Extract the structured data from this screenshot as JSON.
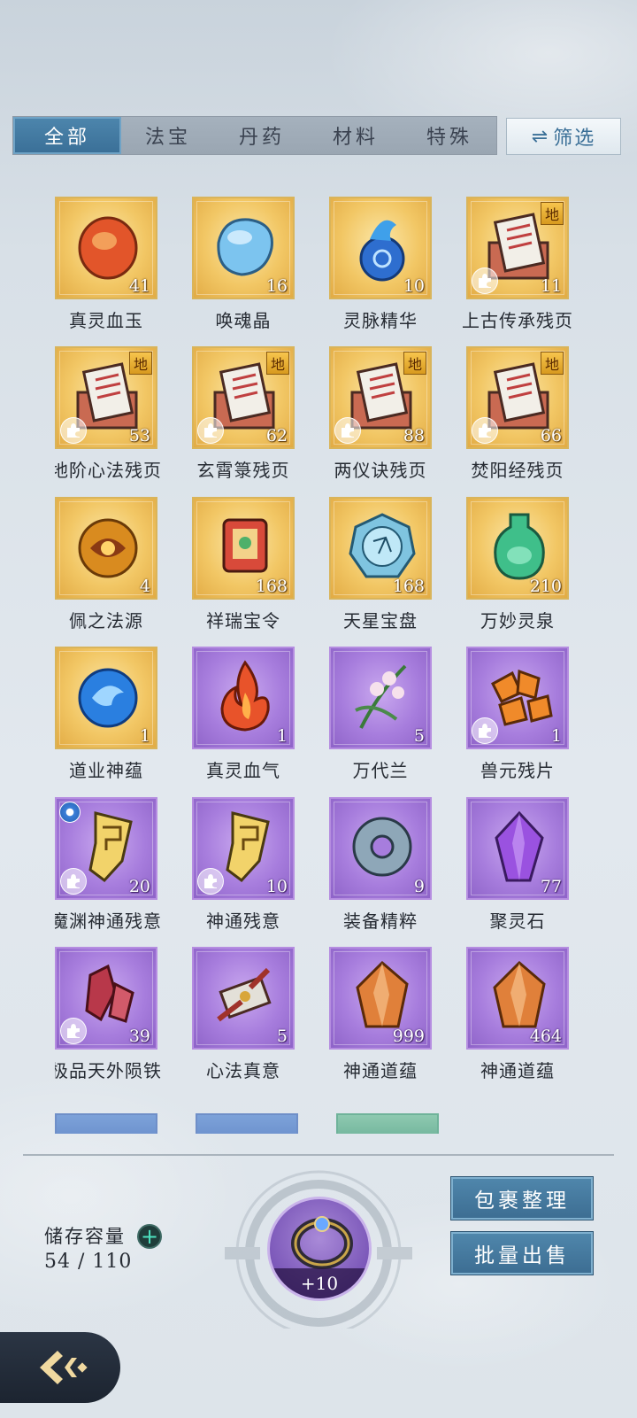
{
  "tabs": [
    {
      "label": "全部",
      "active": true
    },
    {
      "label": "法宝",
      "active": false
    },
    {
      "label": "丹药",
      "active": false
    },
    {
      "label": "材料",
      "active": false
    },
    {
      "label": "特殊",
      "active": false
    }
  ],
  "filter": {
    "icon": "swap-arrows-icon",
    "label": "筛选"
  },
  "items": [
    {
      "name": "真灵血玉",
      "qty": "41",
      "rarity": "gold",
      "art": "blood-jade-icon"
    },
    {
      "name": "唤魂晶",
      "qty": "16",
      "rarity": "gold",
      "art": "soul-crystal-icon"
    },
    {
      "name": "灵脉精华",
      "qty": "10",
      "rarity": "gold",
      "art": "spirit-essence-icon"
    },
    {
      "name": "上古传承残页",
      "qty": "11",
      "rarity": "gold",
      "art": "scroll-page-icon",
      "badge": "地",
      "puzzle": true
    },
    {
      "name": "地阶心法残页",
      "qty": "53",
      "rarity": "gold",
      "art": "scroll-page-icon",
      "badge": "地",
      "puzzle": true
    },
    {
      "name": "玄霄箓残页",
      "qty": "62",
      "rarity": "gold",
      "art": "scroll-page-icon",
      "badge": "地",
      "puzzle": true
    },
    {
      "name": "两仪诀残页",
      "qty": "88",
      "rarity": "gold",
      "art": "scroll-page-icon",
      "badge": "地",
      "puzzle": true
    },
    {
      "name": "焚阳经残页",
      "qty": "66",
      "rarity": "gold",
      "art": "scroll-page-icon",
      "badge": "地",
      "puzzle": true
    },
    {
      "name": "佩之法源",
      "qty": "4",
      "rarity": "gold",
      "art": "golden-orb-icon"
    },
    {
      "name": "祥瑞宝令",
      "qty": "168",
      "rarity": "gold",
      "art": "token-icon"
    },
    {
      "name": "天星宝盘",
      "qty": "168",
      "rarity": "gold",
      "art": "star-disc-icon"
    },
    {
      "name": "万妙灵泉",
      "qty": "210",
      "rarity": "gold",
      "art": "spring-bottle-icon"
    },
    {
      "name": "道业神蕴",
      "qty": "1",
      "rarity": "gold",
      "art": "blue-swirl-orb-icon"
    },
    {
      "name": "真灵血气",
      "qty": "1",
      "rarity": "purple",
      "art": "flame-icon"
    },
    {
      "name": "万代兰",
      "qty": "5",
      "rarity": "purple",
      "art": "orchid-icon"
    },
    {
      "name": "兽元残片",
      "qty": "1",
      "rarity": "purple",
      "art": "beast-shards-icon",
      "puzzle": true
    },
    {
      "name": "魔渊神通残意",
      "qty": "20",
      "rarity": "purple",
      "art": "golden-fragment-icon",
      "puzzle": true,
      "spirit": true
    },
    {
      "name": "神通残意",
      "qty": "10",
      "rarity": "purple",
      "art": "golden-fragment-icon",
      "puzzle": true
    },
    {
      "name": "装备精粹",
      "qty": "9",
      "rarity": "purple",
      "art": "ring-essence-icon"
    },
    {
      "name": "聚灵石",
      "qty": "77",
      "rarity": "purple",
      "art": "purple-crystal-icon"
    },
    {
      "name": "极品天外陨铁",
      "qty": "39",
      "rarity": "purple",
      "art": "meteor-iron-icon",
      "puzzle": true
    },
    {
      "name": "心法真意",
      "qty": "5",
      "rarity": "purple",
      "art": "ornament-icon"
    },
    {
      "name": "神通道蕴",
      "qty": "999",
      "rarity": "purple",
      "art": "orange-crystal-icon"
    },
    {
      "name": "神通道蕴",
      "qty": "464",
      "rarity": "purple",
      "art": "orange-crystal-icon"
    }
  ],
  "storage": {
    "label": "储存容量",
    "value": "54 / 110",
    "add_icon": "plus-icon"
  },
  "center_item": {
    "bonus": "+10",
    "icon": "bracelet-icon"
  },
  "actions": {
    "organize": "包裹整理",
    "bulk_sell": "批量出售"
  },
  "back": {
    "icon": "back-arrow-icon"
  },
  "colors": {
    "gold_tile": "#f2c765",
    "purple_tile": "#a77ddd",
    "tab_active": "#3a6f97",
    "button": "#3d6e93"
  }
}
